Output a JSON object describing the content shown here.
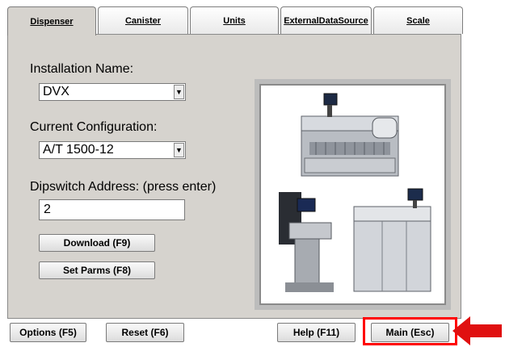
{
  "tabs": [
    {
      "label": "Dispenser",
      "active": true
    },
    {
      "label": "Canister",
      "active": false
    },
    {
      "label": "Units",
      "active": false
    },
    {
      "label": "ExternalDataSource",
      "active": false
    },
    {
      "label": "Scale",
      "active": false
    }
  ],
  "form": {
    "installation_label": "Installation Name:",
    "installation_value": "DVX",
    "config_label": "Current Configuration:",
    "config_value": "A/T 1500-12",
    "dipswitch_label": "Dipswitch Address: (press enter)",
    "dipswitch_value": "2",
    "download_label": "Download (F9)",
    "setparms_label": "Set Parms (F8)"
  },
  "bottom": {
    "options_label": "Options (F5)",
    "reset_label": "Reset (F6)",
    "help_label": "Help (F11)",
    "main_label": "Main (Esc)"
  },
  "colors": {
    "panel": "#d6d3ce",
    "highlight": "#ff0000",
    "arrow": "#e01010"
  },
  "icons": [
    "dropdown-arrow-icon",
    "red-arrow-icon"
  ]
}
